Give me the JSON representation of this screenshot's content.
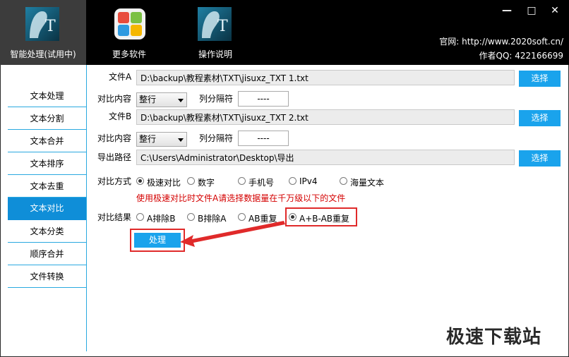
{
  "header": {
    "tools": [
      {
        "label": "智能处理(试用中)",
        "icon": "ts-logo-icon"
      },
      {
        "label": "更多软件",
        "icon": "windows-tiles-icon"
      },
      {
        "label": "操作说明",
        "icon": "ts-logo-icon"
      }
    ],
    "website": "官网: http://www.2020soft.cn/",
    "qq": "作者QQ: 422166699",
    "window_controls": {
      "minimize": "—",
      "maximize": "□",
      "close": "✕"
    }
  },
  "sidebar": {
    "items": [
      {
        "label": "文本处理"
      },
      {
        "label": "文本分割"
      },
      {
        "label": "文本合并"
      },
      {
        "label": "文本排序"
      },
      {
        "label": "文本去重"
      },
      {
        "label": "文本对比"
      },
      {
        "label": "文本分类"
      },
      {
        "label": "顺序合并"
      },
      {
        "label": "文件转换"
      }
    ],
    "active_index": 5
  },
  "form": {
    "file_a": {
      "label": "文件A",
      "value": "D:\\backup\\教程素材\\TXT\\jisuxz_TXT 1.txt",
      "button": "选择"
    },
    "compare_content_a": {
      "label": "对比内容",
      "select": "整行",
      "sep_label": "列分隔符",
      "sep_value": "----"
    },
    "file_b": {
      "label": "文件B",
      "value": "D:\\backup\\教程素材\\TXT\\jisuxz_TXT 2.txt",
      "button": "选择"
    },
    "compare_content_b": {
      "label": "对比内容",
      "select": "整行",
      "sep_label": "列分隔符",
      "sep_value": "----"
    },
    "export_path": {
      "label": "导出路径",
      "value": "C:\\Users\\Administrator\\Desktop\\导出",
      "button": "选择"
    },
    "compare_mode": {
      "label": "对比方式",
      "options": [
        "极速对比",
        "数字",
        "手机号",
        "IPv4",
        "海量文本"
      ],
      "selected": 0,
      "hint": "使用极速对比时文件A请选择数据量在千万级以下的文件"
    },
    "compare_result": {
      "label": "对比结果",
      "options": [
        "A排除B",
        "B排除A",
        "AB重复",
        "A+B-AB重复"
      ],
      "selected": 3
    },
    "run_button": "处理"
  },
  "watermark": "极速下载站",
  "colors": {
    "accent": "#1aa3ec",
    "active_sidebar": "#0f8ed8",
    "highlight": "#e02a2a",
    "hint": "#d40000"
  }
}
